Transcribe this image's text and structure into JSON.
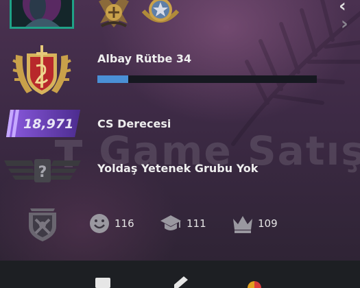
{
  "profile": {
    "rank_name": "Albay Rütbe 34",
    "xp_progress": 0.14,
    "cs_rating_value": "18,971",
    "cs_rating_label": "CS Derecesi",
    "skill_group_label": "Yoldaş Yetenek Grubu Yok"
  },
  "commends": {
    "friendly": "116",
    "teacher": "111",
    "leader": "109"
  },
  "watermark": "Game Satış",
  "colors": {
    "avatar_border": "#1fa287",
    "xp_fill": "#4a90d6",
    "rating_purple": "#7a4bd0",
    "medal_gold": "#c9a14a",
    "rank_red": "#b8282b"
  },
  "icons": {
    "nav_prev": "chevron-left-icon",
    "nav_next": "chevron-right-icon",
    "friendly": "smiley-icon",
    "teacher": "graduation-cap-icon",
    "leader": "crown-icon"
  }
}
